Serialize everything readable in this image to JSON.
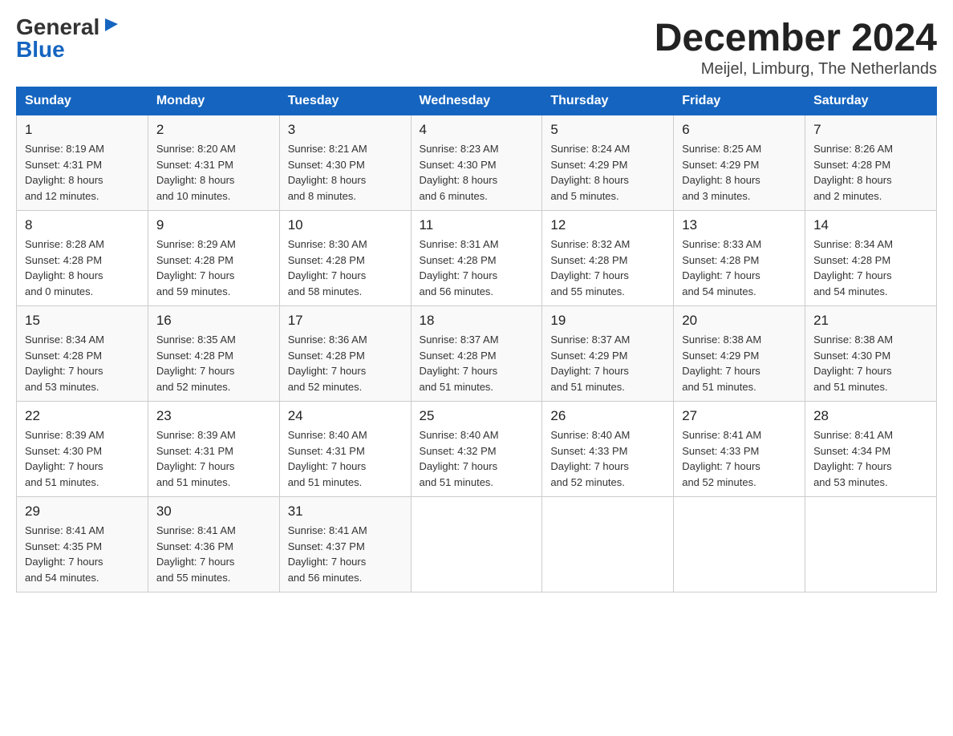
{
  "logo": {
    "general": "General",
    "blue": "Blue",
    "triangle": "▶"
  },
  "title": "December 2024",
  "location": "Meijel, Limburg, The Netherlands",
  "days_of_week": [
    "Sunday",
    "Monday",
    "Tuesday",
    "Wednesday",
    "Thursday",
    "Friday",
    "Saturday"
  ],
  "weeks": [
    [
      {
        "day": "1",
        "sunrise": "8:19 AM",
        "sunset": "4:31 PM",
        "daylight": "8 hours and 12 minutes."
      },
      {
        "day": "2",
        "sunrise": "8:20 AM",
        "sunset": "4:31 PM",
        "daylight": "8 hours and 10 minutes."
      },
      {
        "day": "3",
        "sunrise": "8:21 AM",
        "sunset": "4:30 PM",
        "daylight": "8 hours and 8 minutes."
      },
      {
        "day": "4",
        "sunrise": "8:23 AM",
        "sunset": "4:30 PM",
        "daylight": "8 hours and 6 minutes."
      },
      {
        "day": "5",
        "sunrise": "8:24 AM",
        "sunset": "4:29 PM",
        "daylight": "8 hours and 5 minutes."
      },
      {
        "day": "6",
        "sunrise": "8:25 AM",
        "sunset": "4:29 PM",
        "daylight": "8 hours and 3 minutes."
      },
      {
        "day": "7",
        "sunrise": "8:26 AM",
        "sunset": "4:28 PM",
        "daylight": "8 hours and 2 minutes."
      }
    ],
    [
      {
        "day": "8",
        "sunrise": "8:28 AM",
        "sunset": "4:28 PM",
        "daylight": "8 hours and 0 minutes."
      },
      {
        "day": "9",
        "sunrise": "8:29 AM",
        "sunset": "4:28 PM",
        "daylight": "7 hours and 59 minutes."
      },
      {
        "day": "10",
        "sunrise": "8:30 AM",
        "sunset": "4:28 PM",
        "daylight": "7 hours and 58 minutes."
      },
      {
        "day": "11",
        "sunrise": "8:31 AM",
        "sunset": "4:28 PM",
        "daylight": "7 hours and 56 minutes."
      },
      {
        "day": "12",
        "sunrise": "8:32 AM",
        "sunset": "4:28 PM",
        "daylight": "7 hours and 55 minutes."
      },
      {
        "day": "13",
        "sunrise": "8:33 AM",
        "sunset": "4:28 PM",
        "daylight": "7 hours and 54 minutes."
      },
      {
        "day": "14",
        "sunrise": "8:34 AM",
        "sunset": "4:28 PM",
        "daylight": "7 hours and 54 minutes."
      }
    ],
    [
      {
        "day": "15",
        "sunrise": "8:34 AM",
        "sunset": "4:28 PM",
        "daylight": "7 hours and 53 minutes."
      },
      {
        "day": "16",
        "sunrise": "8:35 AM",
        "sunset": "4:28 PM",
        "daylight": "7 hours and 52 minutes."
      },
      {
        "day": "17",
        "sunrise": "8:36 AM",
        "sunset": "4:28 PM",
        "daylight": "7 hours and 52 minutes."
      },
      {
        "day": "18",
        "sunrise": "8:37 AM",
        "sunset": "4:28 PM",
        "daylight": "7 hours and 51 minutes."
      },
      {
        "day": "19",
        "sunrise": "8:37 AM",
        "sunset": "4:29 PM",
        "daylight": "7 hours and 51 minutes."
      },
      {
        "day": "20",
        "sunrise": "8:38 AM",
        "sunset": "4:29 PM",
        "daylight": "7 hours and 51 minutes."
      },
      {
        "day": "21",
        "sunrise": "8:38 AM",
        "sunset": "4:30 PM",
        "daylight": "7 hours and 51 minutes."
      }
    ],
    [
      {
        "day": "22",
        "sunrise": "8:39 AM",
        "sunset": "4:30 PM",
        "daylight": "7 hours and 51 minutes."
      },
      {
        "day": "23",
        "sunrise": "8:39 AM",
        "sunset": "4:31 PM",
        "daylight": "7 hours and 51 minutes."
      },
      {
        "day": "24",
        "sunrise": "8:40 AM",
        "sunset": "4:31 PM",
        "daylight": "7 hours and 51 minutes."
      },
      {
        "day": "25",
        "sunrise": "8:40 AM",
        "sunset": "4:32 PM",
        "daylight": "7 hours and 51 minutes."
      },
      {
        "day": "26",
        "sunrise": "8:40 AM",
        "sunset": "4:33 PM",
        "daylight": "7 hours and 52 minutes."
      },
      {
        "day": "27",
        "sunrise": "8:41 AM",
        "sunset": "4:33 PM",
        "daylight": "7 hours and 52 minutes."
      },
      {
        "day": "28",
        "sunrise": "8:41 AM",
        "sunset": "4:34 PM",
        "daylight": "7 hours and 53 minutes."
      }
    ],
    [
      {
        "day": "29",
        "sunrise": "8:41 AM",
        "sunset": "4:35 PM",
        "daylight": "7 hours and 54 minutes."
      },
      {
        "day": "30",
        "sunrise": "8:41 AM",
        "sunset": "4:36 PM",
        "daylight": "7 hours and 55 minutes."
      },
      {
        "day": "31",
        "sunrise": "8:41 AM",
        "sunset": "4:37 PM",
        "daylight": "7 hours and 56 minutes."
      },
      null,
      null,
      null,
      null
    ]
  ],
  "labels": {
    "sunrise": "Sunrise:",
    "sunset": "Sunset:",
    "daylight": "Daylight:"
  }
}
